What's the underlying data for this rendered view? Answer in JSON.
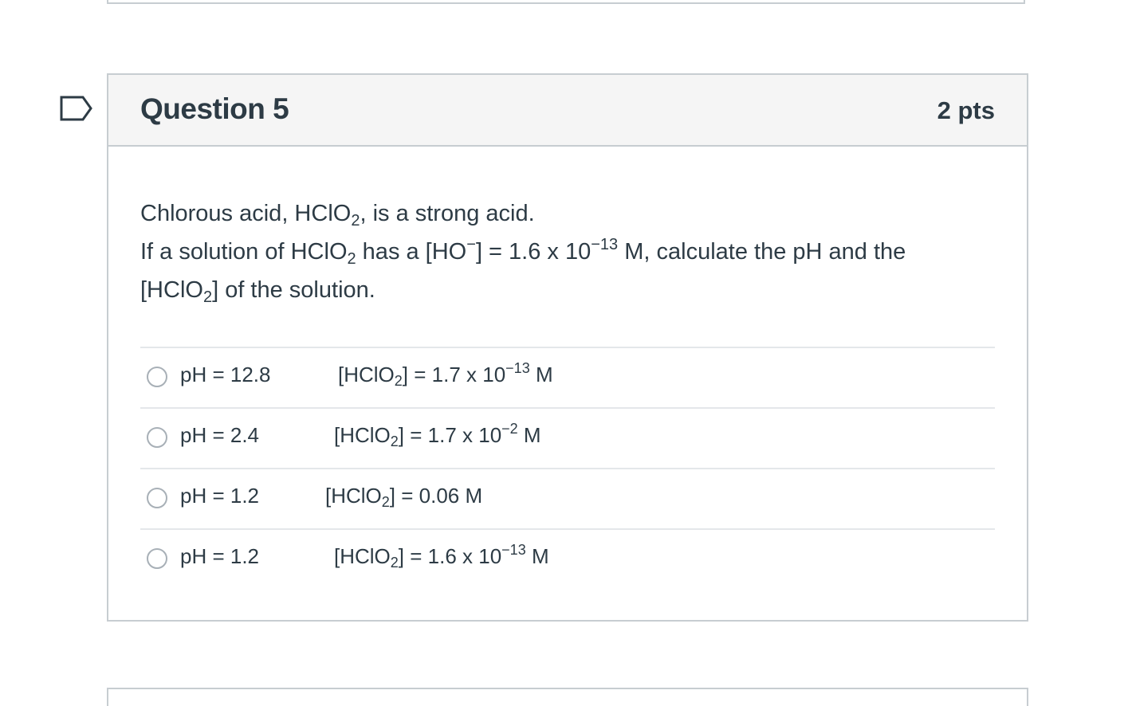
{
  "question": {
    "title": "Question 5",
    "points": "2 pts",
    "text": {
      "line1_a": "Chlorous acid, HClO",
      "line1_sub": "2",
      "line1_b": ", is a strong acid.",
      "line2_a": "If a solution of HClO",
      "line2_sub": "2",
      "line2_b": " has a [HO",
      "line2_sup1": "−",
      "line2_c": "] = 1.6 x 10",
      "line2_sup2": "−13",
      "line2_d": " M,  calculate the pH and the",
      "line3_a": "[HClO",
      "line3_sub": "2",
      "line3_b": "] of the solution."
    }
  },
  "answers": [
    {
      "ph": "pH = 12.8",
      "conc_a": "[HClO",
      "conc_sub": "2",
      "conc_b": "] = 1.7 x 10",
      "conc_sup": "−13",
      "conc_c": " M"
    },
    {
      "ph": "pH = 2.4",
      "conc_a": "[HClO",
      "conc_sub": "2",
      "conc_b": "] = 1.7 x 10",
      "conc_sup": "−2",
      "conc_c": " M"
    },
    {
      "ph": "pH = 1.2",
      "conc_a": "[HClO",
      "conc_sub": "2",
      "conc_b": "] = 0.06 M",
      "conc_sup": "",
      "conc_c": ""
    },
    {
      "ph": "pH = 1.2",
      "conc_a": "[HClO",
      "conc_sub": "2",
      "conc_b": "] = 1.6 x 10",
      "conc_sup": "−13",
      "conc_c": " M"
    }
  ],
  "colors": {
    "text": "#2d3b45",
    "border": "#c7cdd1",
    "header_bg": "#f5f5f5",
    "flag": "#2d3b45"
  },
  "icons": {
    "flag": "flag-question-icon",
    "radio": "radio-unselected-icon"
  }
}
